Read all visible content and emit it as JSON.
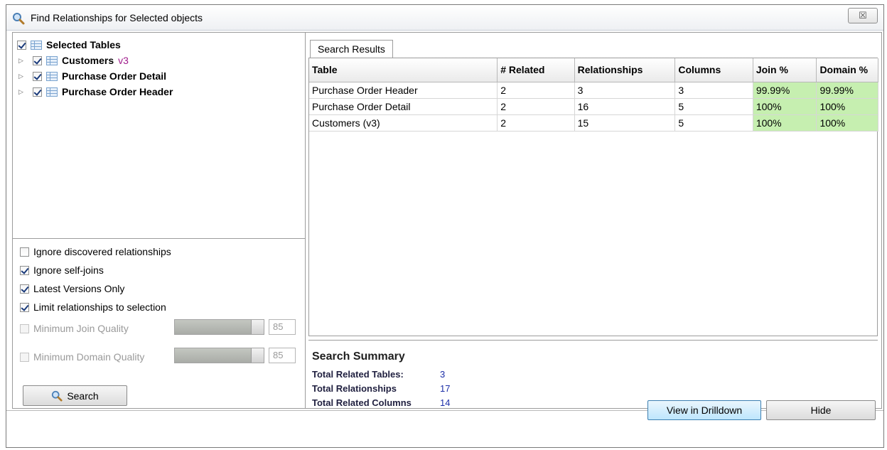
{
  "window": {
    "title": "Find Relationships for Selected objects",
    "close_label": "☒"
  },
  "tree": {
    "root_label": "Selected Tables",
    "items": [
      {
        "label": "Customers",
        "version": "v3"
      },
      {
        "label": "Purchase Order Detail",
        "version": ""
      },
      {
        "label": "Purchase Order Header",
        "version": ""
      }
    ]
  },
  "options": {
    "ignore_discovered": "Ignore discovered relationships",
    "ignore_self_joins": "Ignore self-joins",
    "latest_versions": "Latest Versions Only",
    "limit_to_selection": "Limit relationships to selection",
    "min_join_quality": {
      "label": "Minimum Join Quality",
      "value": "85"
    },
    "min_domain_quality": {
      "label": "Minimum Domain Quality",
      "value": "85"
    },
    "search_label": "Search"
  },
  "results": {
    "tab_label": "Search Results",
    "columns": [
      "Table",
      "# Related",
      "Relationships",
      "Columns",
      "Join %",
      "Domain %"
    ],
    "rows": [
      [
        "Purchase Order Header",
        "2",
        "3",
        "3",
        "99.99%",
        "99.99%"
      ],
      [
        "Purchase Order Detail",
        "2",
        "16",
        "5",
        "100%",
        "100%"
      ],
      [
        "Customers (v3)",
        "2",
        "15",
        "5",
        "100%",
        "100%"
      ]
    ]
  },
  "summary": {
    "title": "Search Summary",
    "total_related_tables_label": "Total Related Tables:",
    "total_related_tables": "3",
    "total_relationships_label": "Total Relationships",
    "total_relationships": "17",
    "total_related_columns_label": "Total Related Columns",
    "total_related_columns": "14"
  },
  "footer": {
    "view_drilldown": "View in Drilldown",
    "hide": "Hide"
  },
  "colors": {
    "match_green": "#c6efb0",
    "version_purple": "#a01d8c",
    "summary_value_blue": "#1d2fa8"
  }
}
